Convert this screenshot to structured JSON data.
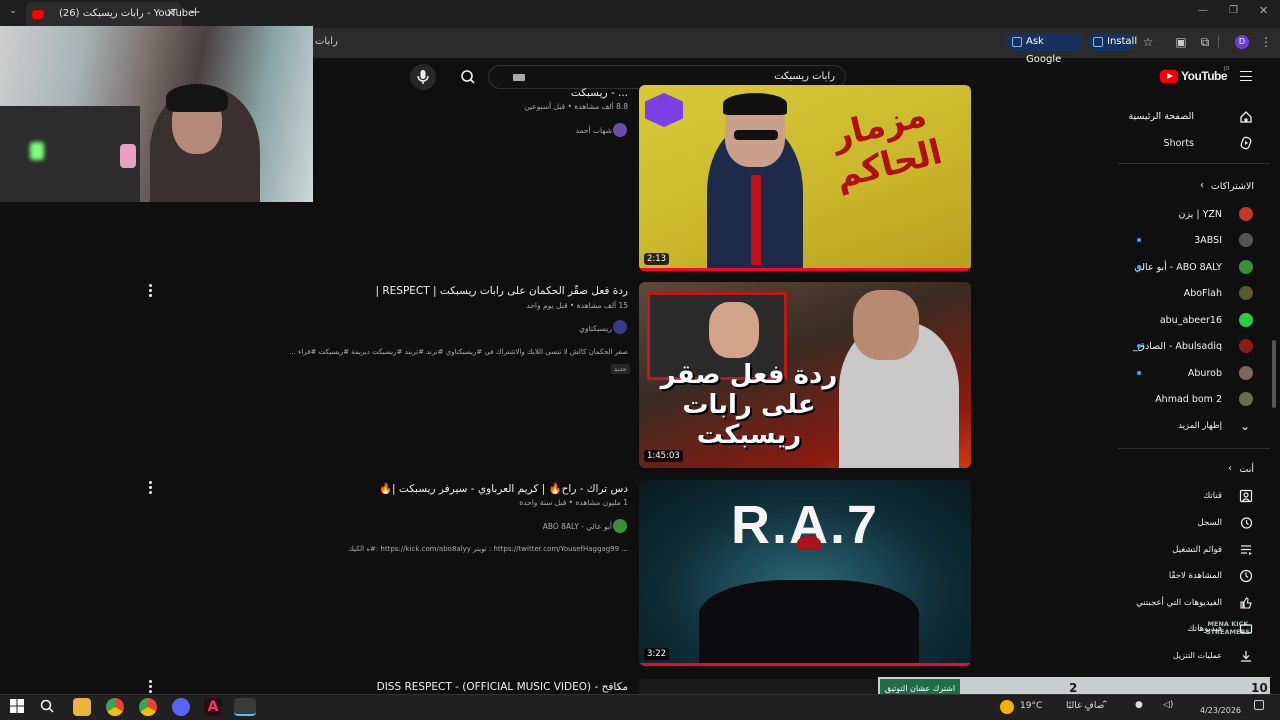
{
  "browser": {
    "tab_title": "(26) رابات ريسبكت - YouTube",
    "url": "رابات",
    "ask_google": "Ask Google",
    "install": "Install",
    "profile_initial": "D"
  },
  "youtube": {
    "logo_text": "YouTube",
    "logo_country": "JO",
    "search_query": "رابات ريسبكت"
  },
  "sidebar": {
    "main": [
      {
        "label": "الصفحة الرئيسية",
        "icon": "home-icon"
      },
      {
        "label": "Shorts",
        "icon": "shorts-icon"
      }
    ],
    "subscriptions_header": "الاشتراكات",
    "subscriptions": [
      {
        "label": "YZN | يزن",
        "new": false,
        "color": "#c0392b"
      },
      {
        "label": "3ABSI",
        "new": true,
        "color": "#555555"
      },
      {
        "label": "ABO 8ALY - أبو عالي",
        "new": true,
        "color": "#3a8f3a"
      },
      {
        "label": "AboFlah",
        "new": false,
        "color": "#5a5a30"
      },
      {
        "label": "abu_abeer16",
        "new": false,
        "color": "#2ecc40"
      },
      {
        "label": "Abulsadiq - الصادق_",
        "new": true,
        "color": "#8b1a1a"
      },
      {
        "label": "Aburob",
        "new": true,
        "color": "#7a6a5a"
      },
      {
        "label": "Ahmad bom 2",
        "new": false,
        "color": "#6a6a50"
      }
    ],
    "show_more": "إظهار المزيد",
    "you_header": "أنت",
    "you_items": [
      {
        "label": "قناتك",
        "icon": "account-box-icon"
      },
      {
        "label": "السجل",
        "icon": "history-icon"
      },
      {
        "label": "قوائم التشغيل",
        "icon": "playlist-icon"
      },
      {
        "label": "المشاهدة لاحقًا",
        "icon": "clock-icon"
      },
      {
        "label": "الفيديوهات التي أعجبتني",
        "icon": "thumbs-up-icon"
      },
      {
        "label": "فيديوهاتك",
        "icon": "video-icon"
      },
      {
        "label": "عمليات التنزيل",
        "icon": "download-icon"
      }
    ]
  },
  "videos": [
    {
      "title": "... - ريسبكت",
      "meta": "8.8 ألف مشاهدة • قبل أسبوعين",
      "channel": "شهاب أحمد",
      "duration": "2:13",
      "thumb_text": "مزمار الحاكم"
    },
    {
      "title": "ردة فعل صقّر الحكمان على رابات ريسبكت | RESPECT |",
      "meta": "15 ألف مشاهدة • قبل يوم واحد",
      "channel": "ريسبكتاوي",
      "description": "صقر الحكمان كالش لا تنسى اللايك والاشتراك في #ريسبكتاوي #ترند #تريند #ريسبكت ديريمة #ريسبكت #فراء ...",
      "badge": "جديد",
      "duration": "1:45:03",
      "thumb_text": "ردة فعل صقر على رابات ريسبكت"
    },
    {
      "title": "دس تراك - راح🔥 | كريم العرباوي - سيرفر ريسبكت |🔥",
      "meta": "1 مليون مشاهدة • قبل سنة واحدة",
      "channel": "ABO 8ALY - أبو عالي",
      "description": "... https://twitter.com/YousefHaggag99 : تويتر https://kick.com/abo8alyy :#ه الكيك",
      "duration": "3:22",
      "thumb_text": "R.A.7"
    },
    {
      "title": "مكافح - DISS RESPECT - (OFFICIAL MUSIC VIDEO)"
    }
  ],
  "overlay": {
    "subscribe_text": "اشترك عشان التوثيق",
    "count_a": "2",
    "count_b": "10",
    "watermark": "MENA KICK STREAMERS"
  },
  "taskbar": {
    "temperature": "19°C",
    "weather": "صافٍ غالبًا",
    "date": "4/23/2026"
  }
}
